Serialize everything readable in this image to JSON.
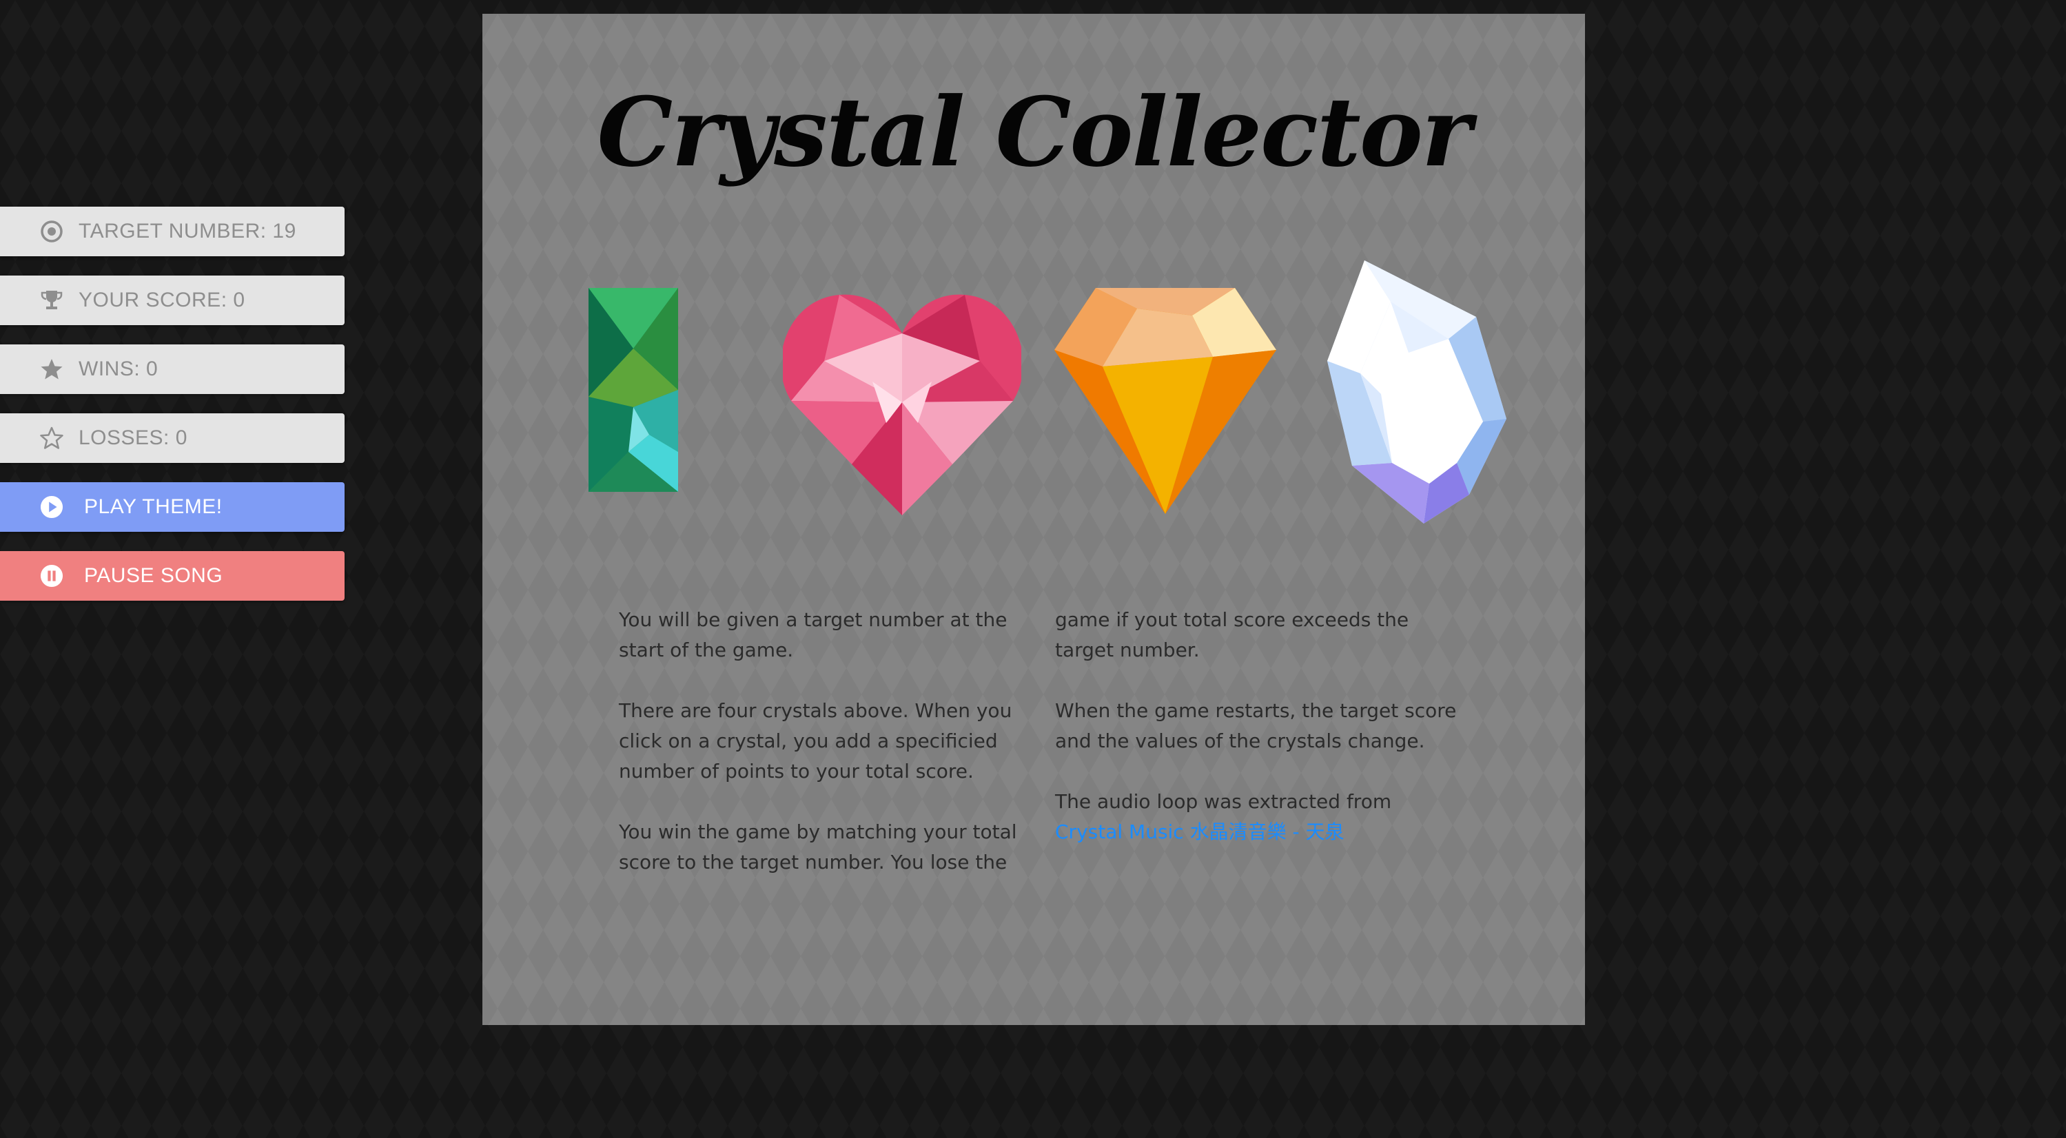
{
  "sidebar": {
    "target": {
      "label": "TARGET NUMBER: 19",
      "icon": "target-icon"
    },
    "score": {
      "label": "YOUR SCORE: 0",
      "icon": "trophy-icon"
    },
    "wins": {
      "label": "WINS: 0",
      "icon": "star-filled-icon"
    },
    "losses": {
      "label": "LOSSES: 0",
      "icon": "star-outline-icon"
    },
    "play": {
      "label": "PLAY THEME!",
      "icon": "play-icon",
      "color": "#7f9cf5"
    },
    "pause": {
      "label": "PAUSE SONG",
      "icon": "pause-icon",
      "color": "#f08080"
    }
  },
  "game": {
    "title": "Crystal Collector",
    "crystals": [
      {
        "name": "green-crystal"
      },
      {
        "name": "pink-heart-crystal"
      },
      {
        "name": "orange-diamond-crystal"
      },
      {
        "name": "white-marquise-crystal"
      }
    ]
  },
  "instructions": {
    "p1": "You will be given a target number at the start of the game.",
    "p2": "There are four crystals above. When you click on a crystal, you add a specificied number of points to your total score.",
    "p3": "You win the game by matching your total score to the target number. You lose the game if yout total score exceeds the target number.",
    "p4": "When the game restarts, the target score and the values of the crystals change.",
    "p5": "The audio loop was extracted from",
    "link": "Crystal Music 水晶清音樂 - 天泉"
  }
}
